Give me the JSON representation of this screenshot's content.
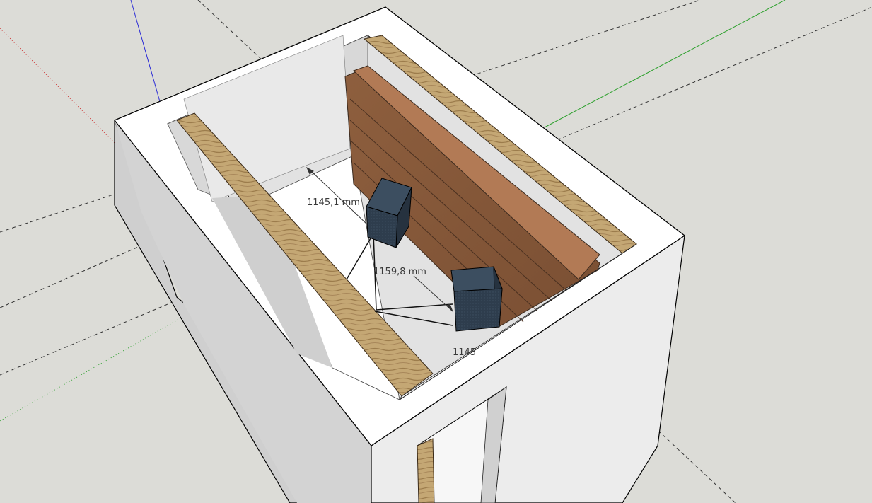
{
  "scene": {
    "background_color": "#dcdcd7",
    "dimensions": [
      {
        "label": "1145,1 mm"
      },
      {
        "label": "1159,8 mm"
      },
      {
        "label": "1145"
      }
    ],
    "axes": {
      "red": "#cc3333",
      "green": "#2fa12f",
      "blue": "#2b2bd6"
    },
    "materials": {
      "wall_top": "#ffffff",
      "wall_face": "#e6e6e6",
      "wall_shadow": "#c8c8c8",
      "wood_light": "#bfa070",
      "wood_dark": "#8a5a3a",
      "speaker": "#2b3a4a"
    }
  }
}
